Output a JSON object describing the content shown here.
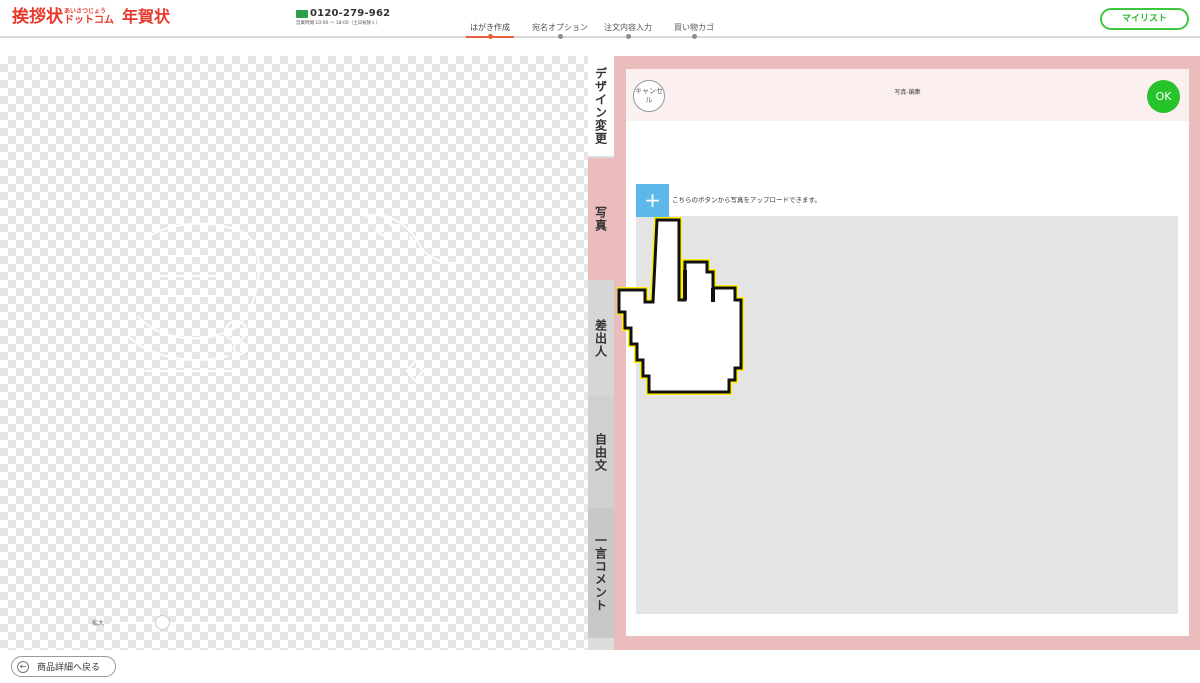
{
  "header": {
    "logo_main": "挨拶状",
    "logo_kana_top": "あいさつじょう",
    "logo_kana_bottom": "ドットコム",
    "logo_nenga": "年賀状",
    "phone_number": "0120-279-962",
    "phone_hours": "営業時間 10:00 ～ 18:00（土日祝除く）",
    "steps": [
      {
        "label": "はがき作成",
        "active": true
      },
      {
        "label": "宛名オプション",
        "active": false
      },
      {
        "label": "注文内容入力",
        "active": false
      },
      {
        "label": "買い物カゴ",
        "active": false
      }
    ],
    "mylist_label": "マイリスト"
  },
  "canvas": {
    "zoom_label": "拡大",
    "zoom_level": 0.15
  },
  "tabs": [
    {
      "label": "デザイン変更"
    },
    {
      "label": "写真"
    },
    {
      "label": "差出人"
    },
    {
      "label": "自由文"
    },
    {
      "label": "一言コメント"
    }
  ],
  "panel": {
    "cancel_label": "キャンセル",
    "title": "写真-編集",
    "ok_label": "OK",
    "add_symbol": "+",
    "upload_hint": "こちらのボタンから写真をアップロードできます。"
  },
  "footer": {
    "back_label": "商品詳細へ戻る",
    "back_icon": "arrow-left-icon"
  },
  "colors": {
    "brand_red": "#e8382c",
    "accent_green": "#27c32b",
    "panel_pink": "#ebbcbc",
    "add_blue": "#5bb8e8"
  }
}
